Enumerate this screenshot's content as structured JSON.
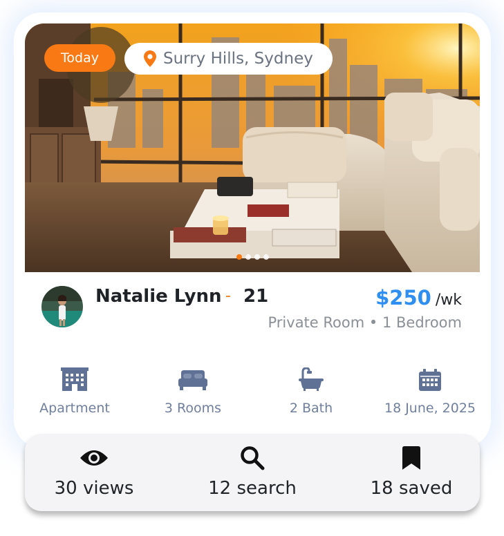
{
  "listing": {
    "badge": "Today",
    "location": "Surry Hills, Sydney",
    "carousel": {
      "count": 4,
      "active_index": 0
    }
  },
  "host": {
    "name": "Natalie Lynn",
    "separator": "-",
    "age": "21"
  },
  "pricing": {
    "amount": "$250",
    "period": "/wk",
    "room_type": "Private Room",
    "bullet": "•",
    "bedrooms": "1 Bedroom"
  },
  "features": [
    {
      "icon": "building-icon",
      "label": "Apartment"
    },
    {
      "icon": "bed-icon",
      "label": "3 Rooms"
    },
    {
      "icon": "bathtub-icon",
      "label": "2 Bath"
    },
    {
      "icon": "calendar-icon",
      "label": "18 June, 2025"
    }
  ],
  "stats": [
    {
      "icon": "eye-icon",
      "label": "30 views"
    },
    {
      "icon": "search-icon",
      "label": "12 search"
    },
    {
      "icon": "bookmark-icon",
      "label": "18 saved"
    }
  ],
  "colors": {
    "accent": "#f97a14",
    "price": "#2f8ff0",
    "feature_icon": "#5f7194",
    "text": "#1f2328",
    "muted": "#8b8f96"
  }
}
